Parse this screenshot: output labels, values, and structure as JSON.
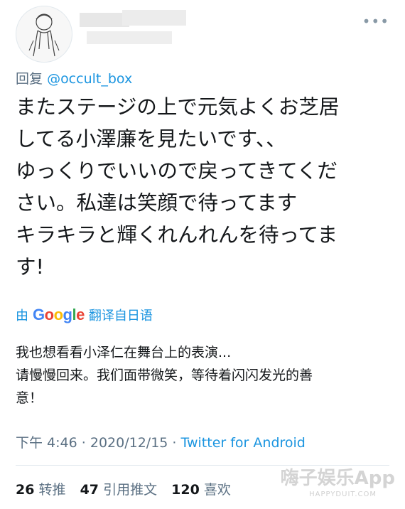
{
  "reply": {
    "prefix": "回复",
    "handle": "@occult_box"
  },
  "tweet_lines": [
    "またステージの上で元気よくお芝居",
    "してる小澤廉を見たいです、、",
    "ゆっくりでいいので戻ってきてくだ",
    "さい。私達は笑顔で待ってます",
    "キラキラと輝くれんれんを待ってま",
    "す!"
  ],
  "translation": {
    "by_label": "由",
    "provider": "Google",
    "suffix": "翻译自日语",
    "lines": [
      "我也想看看小泽仁在舞台上的表演...",
      "请慢慢回来。我们面带微笑，等待着闪闪发光的善",
      "意！"
    ]
  },
  "meta": {
    "time": "下午 4:46",
    "date": "2020/12/15",
    "source": "Twitter for Android"
  },
  "stats": {
    "retweets_count": "26",
    "retweets_label": "转推",
    "quotes_count": "47",
    "quotes_label": "引用推文",
    "likes_count": "120",
    "likes_label": "喜欢"
  },
  "watermark": {
    "main": "嗨子娱乐App",
    "sub": "HAPPYDUIT.COM"
  }
}
